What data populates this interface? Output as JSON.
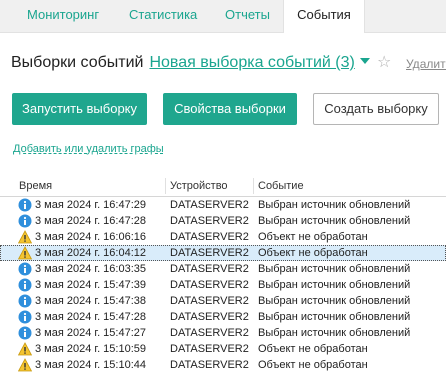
{
  "tabs": [
    {
      "label": "Мониторинг",
      "active": false
    },
    {
      "label": "Статистика",
      "active": false
    },
    {
      "label": "Отчеты",
      "active": false
    },
    {
      "label": "События",
      "active": true
    }
  ],
  "heading": {
    "title": "Выборки событий",
    "selection_link": "Новая выборка событий (3)",
    "delete_link": "Удалить"
  },
  "buttons": {
    "run": "Запустить выборку",
    "properties": "Свойства выборки",
    "create": "Создать выборку"
  },
  "add_columns_link": "Добавить или удалить графы",
  "table": {
    "columns": {
      "time": "Время",
      "device": "Устройство",
      "event": "Событие"
    },
    "rows": [
      {
        "icon": "info-icon",
        "time": "3 мая 2024 г. 16:47:29",
        "device": "DATASERVER2",
        "event": "Выбран источник обновлений",
        "selected": false
      },
      {
        "icon": "info-icon",
        "time": "3 мая 2024 г. 16:47:28",
        "device": "DATASERVER2",
        "event": "Выбран источник обновлений",
        "selected": false
      },
      {
        "icon": "warning-icon",
        "time": "3 мая 2024 г. 16:06:16",
        "device": "DATASERVER2",
        "event": "Объект не обработан",
        "selected": false
      },
      {
        "icon": "warning-icon",
        "time": "3 мая 2024 г. 16:04:12",
        "device": "DATASERVER2",
        "event": "Объект не обработан",
        "selected": true
      },
      {
        "icon": "info-icon",
        "time": "3 мая 2024 г. 16:03:35",
        "device": "DATASERVER2",
        "event": "Выбран источник обновлений",
        "selected": false
      },
      {
        "icon": "info-icon",
        "time": "3 мая 2024 г. 15:47:39",
        "device": "DATASERVER2",
        "event": "Выбран источник обновлений",
        "selected": false
      },
      {
        "icon": "info-icon",
        "time": "3 мая 2024 г. 15:47:38",
        "device": "DATASERVER2",
        "event": "Выбран источник обновлений",
        "selected": false
      },
      {
        "icon": "info-icon",
        "time": "3 мая 2024 г. 15:47:28",
        "device": "DATASERVER2",
        "event": "Выбран источник обновлений",
        "selected": false
      },
      {
        "icon": "info-icon",
        "time": "3 мая 2024 г. 15:47:27",
        "device": "DATASERVER2",
        "event": "Выбран источник обновлений",
        "selected": false
      },
      {
        "icon": "warning-icon",
        "time": "3 мая 2024 г. 15:10:59",
        "device": "DATASERVER2",
        "event": "Объект не обработан",
        "selected": false
      },
      {
        "icon": "warning-icon",
        "time": "3 мая 2024 г. 15:10:44",
        "device": "DATASERVER2",
        "event": "Объект не обработан",
        "selected": false
      }
    ]
  },
  "colors": {
    "accent": "#1fa68e",
    "link": "#1aa58f",
    "info": "#2f8fdc",
    "warning": "#f4c430",
    "selected_row": "#d9ecfa"
  }
}
